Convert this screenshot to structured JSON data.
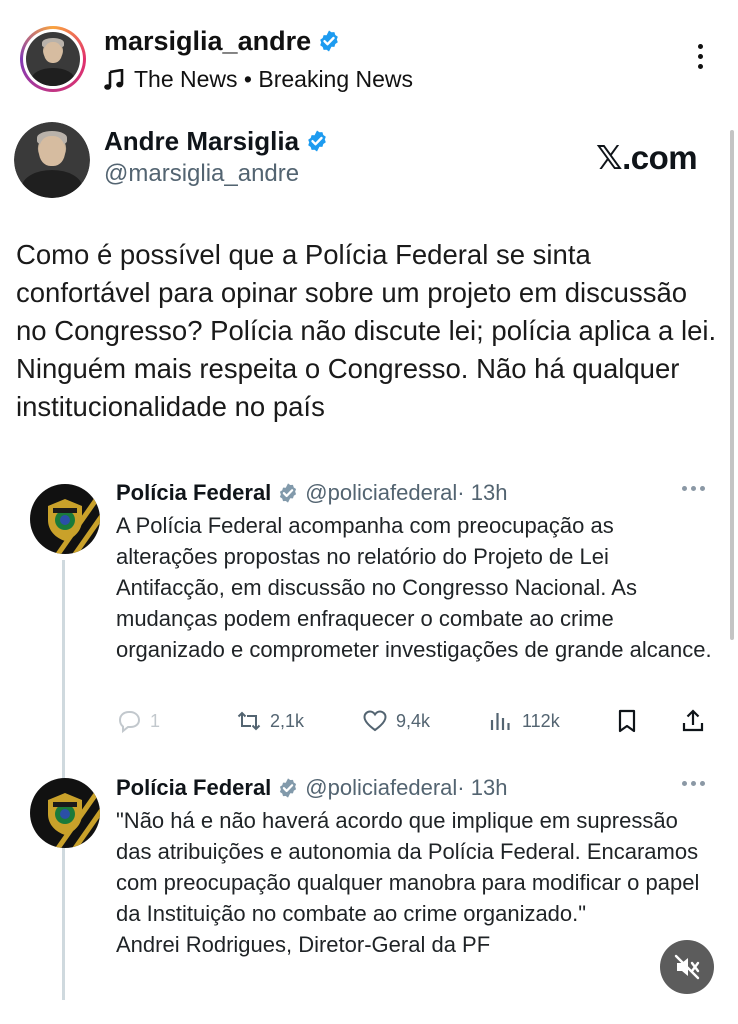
{
  "header": {
    "username": "marsiglia_andre",
    "music": "The News • Breaking News"
  },
  "tweet": {
    "name": "Andre Marsiglia",
    "handle": "@marsiglia_andre",
    "brand": "𝕏.com",
    "text": "Como é possível que a Polícia Federal se sinta confortável para opinar sobre um projeto em discussão no Congresso? Polícia não discute lei; polícia aplica a lei. Ninguém mais respeita o Congresso. Não há qualquer institucionalidade no país"
  },
  "posts": [
    {
      "name": "Polícia Federal",
      "handle": "@policiafederal",
      "time": "· 13h",
      "body": "A Polícia Federal acompanha com preocupação as alterações propostas no relatório do Projeto de Lei Antifacção, em discussão no Congresso Nacional. As mudanças podem enfraquecer o combate ao crime organizado e comprometer investigações de grande alcance.",
      "replies": "1",
      "reposts": "2,1k",
      "likes": "9,4k",
      "views": "112k"
    },
    {
      "name": "Polícia Federal",
      "handle": "@policiafederal",
      "time": "· 13h",
      "body": "\"Não há e não haverá acordo que implique em supressão das atribuições e autonomia da Polícia Federal. Encaramos com preocupação qualquer manobra para modificar o papel da Instituição no combate ao crime organizado.\"",
      "signature": "Andrei Rodrigues, Diretor-Geral da PF"
    }
  ],
  "colors": {
    "verified": "#1d9bf0",
    "text_secondary": "#536471",
    "pf_gold": "#c9a12a"
  }
}
